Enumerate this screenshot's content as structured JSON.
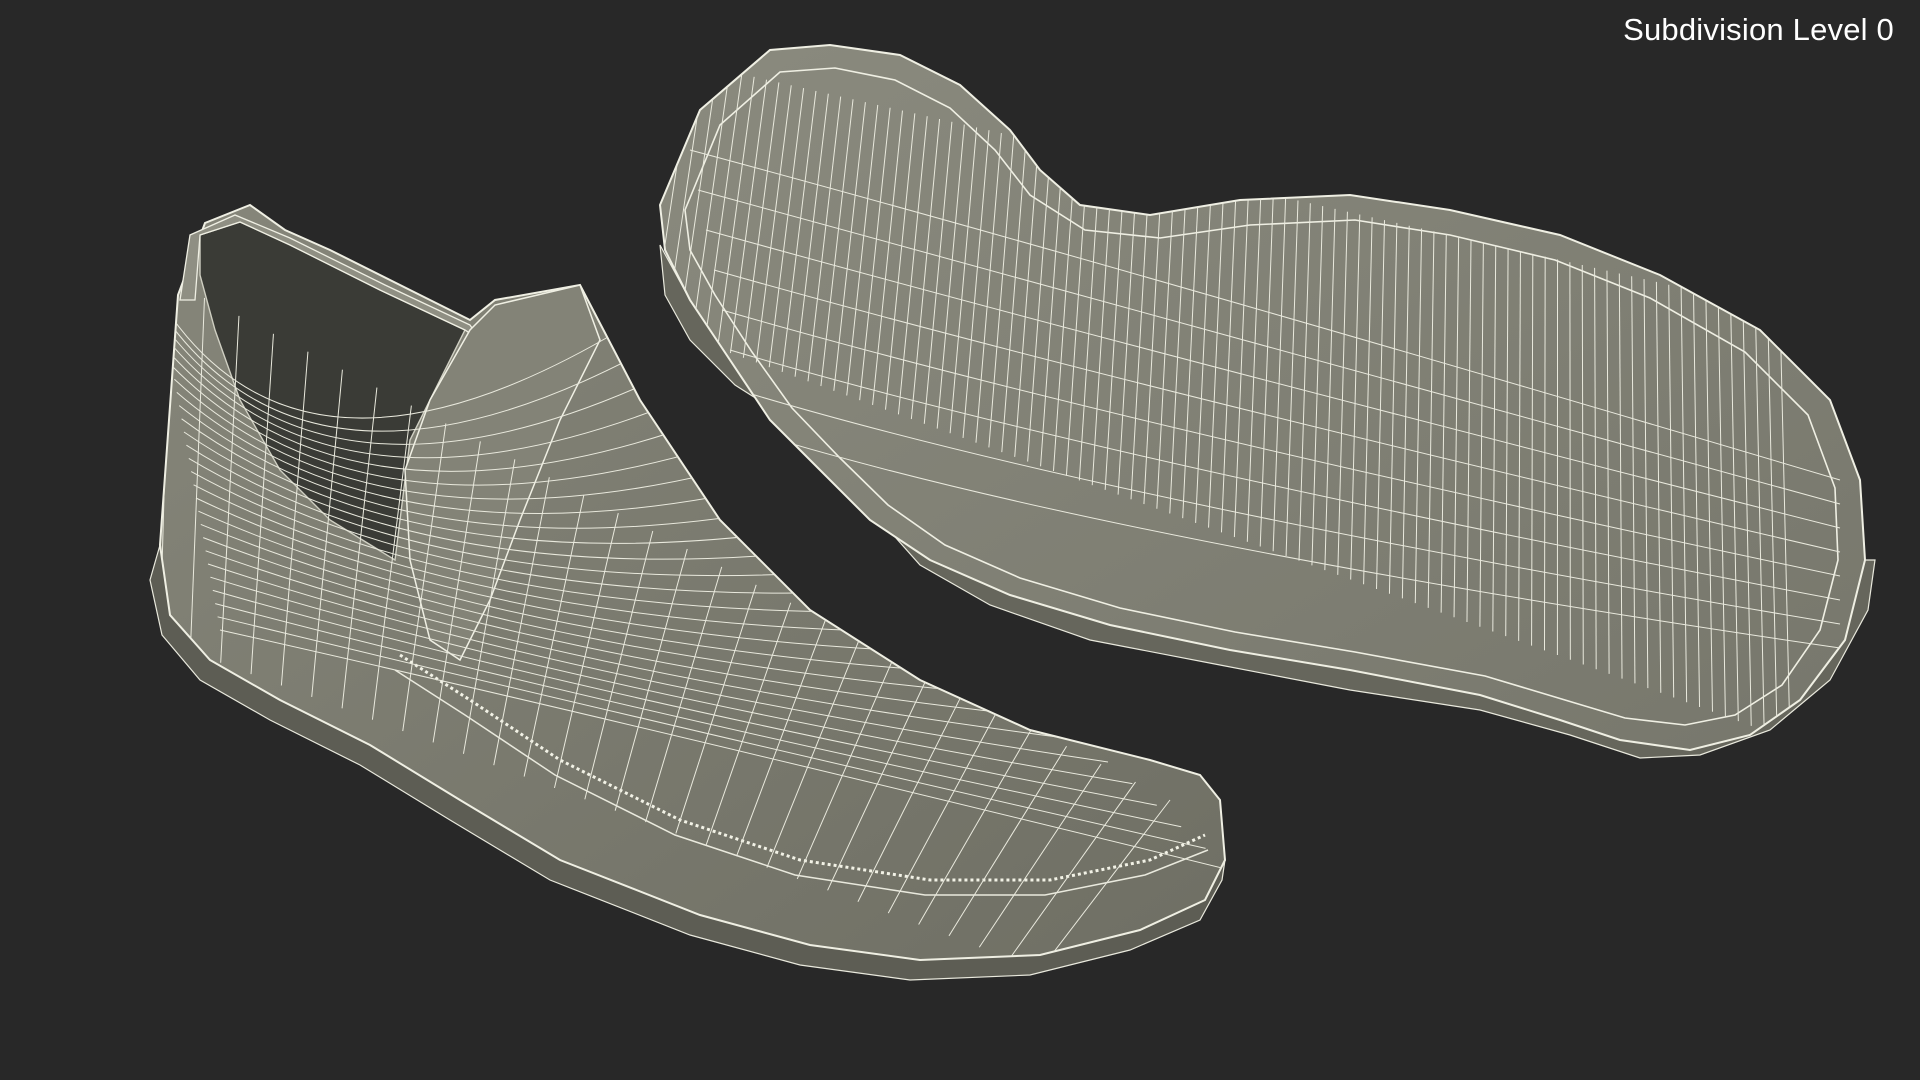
{
  "viewport": {
    "subdivision_label": "Subdivision Level 0",
    "background_color": "#282828",
    "mesh_fill_color": "#7c7c6f",
    "mesh_shadow_color": "#5f5f55",
    "inner_color": "#3a3b36",
    "wire_color": "#e9e9dd"
  }
}
